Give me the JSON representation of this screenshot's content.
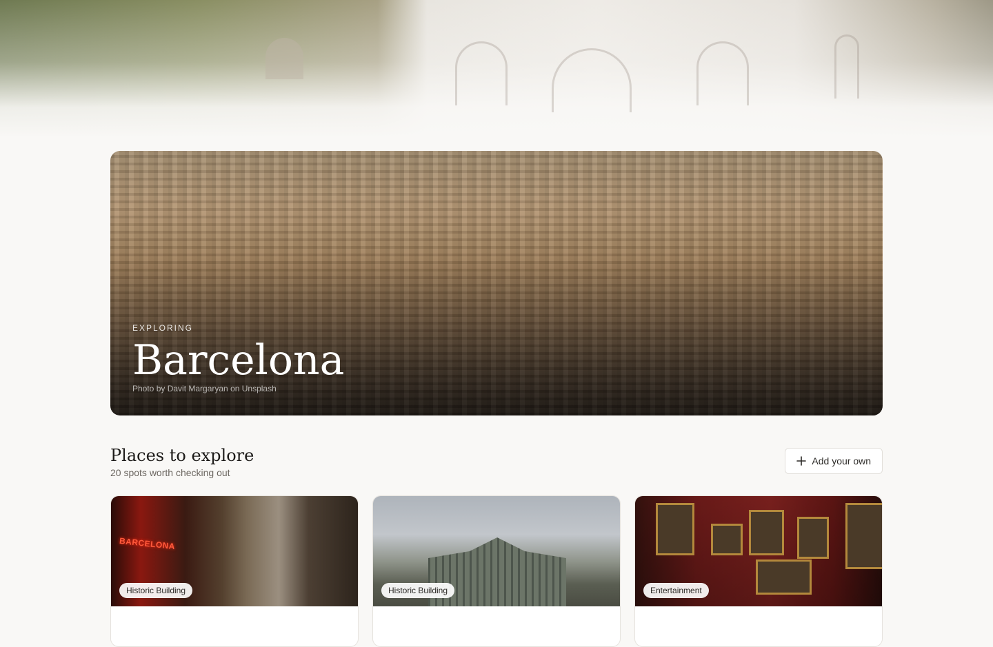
{
  "hero": {
    "eyebrow": "EXPLORING",
    "title": "Barcelona",
    "credit": "Photo by Davit Margaryan on Unsplash"
  },
  "places": {
    "title": "Places to explore",
    "subtitle": "20 spots worth checking out",
    "add_label": "Add your own"
  },
  "cards": [
    {
      "tag": "Historic Building",
      "sign": "BARCELONA"
    },
    {
      "tag": "Historic Building"
    },
    {
      "tag": "Entertainment"
    }
  ],
  "colors": {
    "background": "#f9f8f6",
    "text": "#1d1b19",
    "muted_text": "#6b6660"
  },
  "icons": {
    "add": "plus-icon"
  }
}
